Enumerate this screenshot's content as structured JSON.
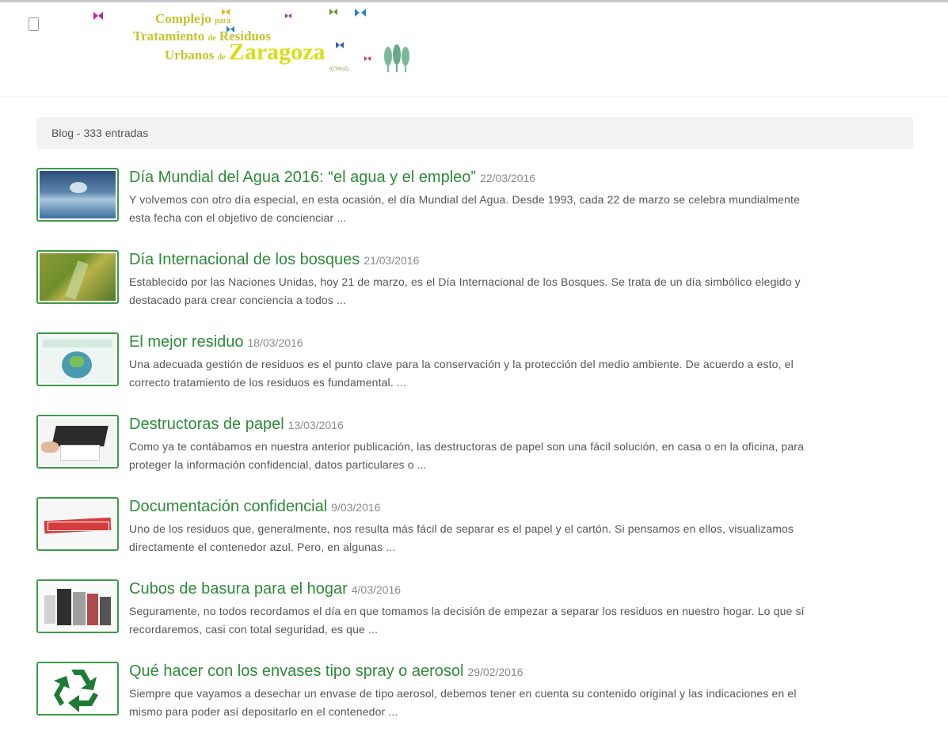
{
  "header": {
    "logo": {
      "line1_a": "Complejo",
      "line1_b": "para",
      "line2_a": "Tratamiento",
      "line2_b": "de",
      "line2_c": "Residuos",
      "line3_a": "Urbanos",
      "line3_b": "de",
      "line3_c": "Zaragoza",
      "line4": "(CTRUZ)"
    },
    "menu_icon": "menu-icon"
  },
  "blog": {
    "label": "Blog - 333 entradas"
  },
  "posts": [
    {
      "title": "Día Mundial del Agua 2016: “el agua y el empleo”",
      "date": "22/03/2016",
      "excerpt_1": "Y volvemos con otro día especial, en esta ocasión, el día Mundial del Agua. Desde 1993, cada 22 de marzo se celebra mundialmente",
      "excerpt_2": "esta fecha con el objetivo de concienciar ..."
    },
    {
      "title": "Día Internacional de los bosques",
      "date": "21/03/2016",
      "excerpt_1": "Establecido por las Naciones Unidas, hoy 21 de marzo, es el Día Internacional de los Bosques. Se trata de un día simbólico elegido y",
      "excerpt_2": "destacado para crear conciencia a todos ..."
    },
    {
      "title": "El mejor residuo",
      "date": "18/03/2016",
      "excerpt_1": "Una adecuada gestión de residuos es el punto clave para la conservación y la protección del medio ambiente. De acuerdo a esto, el",
      "excerpt_2": "correcto tratamiento de los residuos es fundamental. ..."
    },
    {
      "title": "Destructoras de papel",
      "date": "13/03/2016",
      "excerpt_1": "Como ya te contábamos en nuestra anterior publicación, las destructoras de papel son una fácil solución, en casa o en la oficina, para",
      "excerpt_2": "proteger la información confidencial, datos particulares o ..."
    },
    {
      "title": "Documentación confidencial",
      "date": "9/03/2016",
      "excerpt_1": "Uno de los residuos que, generalmente, nos resulta más fácil de separar es el papel y el cartón. Si pensamos en ellos, visualizamos",
      "excerpt_2": "directamente el contenedor azul. Pero, en algunas ..."
    },
    {
      "title": "Cubos de basura para el hogar",
      "date": "4/03/2016",
      "excerpt_1": "Seguramente, no todos recordamos el día en que tomamos la decisión de empezar a separar los residuos en nuestro hogar. Lo que sí",
      "excerpt_2": "recordaremos, casi con total seguridad, es que ..."
    },
    {
      "title": "Qué hacer con los envases tipo spray o aerosol",
      "date": "29/02/2016",
      "excerpt_1": "Siempre que vayamos a desechar un envase de tipo aerosol, debemos tener en cuenta su contenido original y las indicaciones en el",
      "excerpt_2": "mismo para poder así depositarlo en el contenedor ..."
    }
  ],
  "colors": {
    "title_green": "#2d8a38",
    "thumb_border": "#3d9b47",
    "logo_yellow": "#c3c52d"
  }
}
